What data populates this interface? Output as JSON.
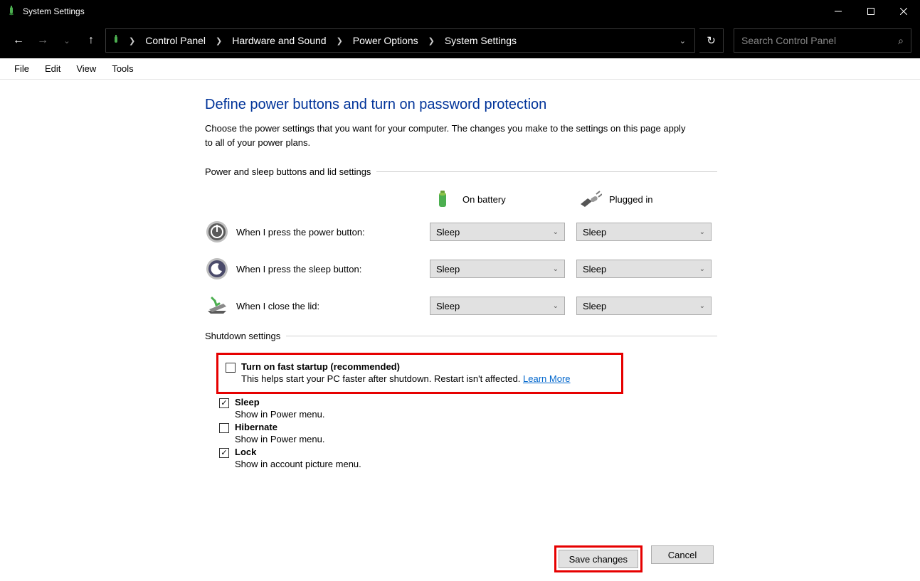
{
  "titlebar": {
    "title": "System Settings"
  },
  "breadcrumb": {
    "items": [
      "Control Panel",
      "Hardware and Sound",
      "Power Options",
      "System Settings"
    ]
  },
  "search": {
    "placeholder": "Search Control Panel"
  },
  "menu": {
    "file": "File",
    "edit": "Edit",
    "view": "View",
    "tools": "Tools"
  },
  "page": {
    "heading": "Define power buttons and turn on password protection",
    "lead": "Choose the power settings that you want for your computer. The changes you make to the settings on this page apply to all of your power plans.",
    "section_buttons": "Power and sleep buttons and lid settings",
    "col_battery": "On battery",
    "col_plugged": "Plugged in",
    "rows": [
      {
        "label": "When I press the power button:",
        "battery": "Sleep",
        "plugged": "Sleep"
      },
      {
        "label": "When I press the sleep button:",
        "battery": "Sleep",
        "plugged": "Sleep"
      },
      {
        "label": "When I close the lid:",
        "battery": "Sleep",
        "plugged": "Sleep"
      }
    ],
    "section_shutdown": "Shutdown settings",
    "shutdown": {
      "fast_startup": {
        "title": "Turn on fast startup (recommended)",
        "desc": "This helps start your PC faster after shutdown. Restart isn't affected. ",
        "link": "Learn More",
        "checked": false
      },
      "sleep": {
        "title": "Sleep",
        "desc": "Show in Power menu.",
        "checked": true
      },
      "hibernate": {
        "title": "Hibernate",
        "desc": "Show in Power menu.",
        "checked": false
      },
      "lock": {
        "title": "Lock",
        "desc": "Show in account picture menu.",
        "checked": true
      }
    }
  },
  "buttons": {
    "save": "Save changes",
    "cancel": "Cancel"
  }
}
